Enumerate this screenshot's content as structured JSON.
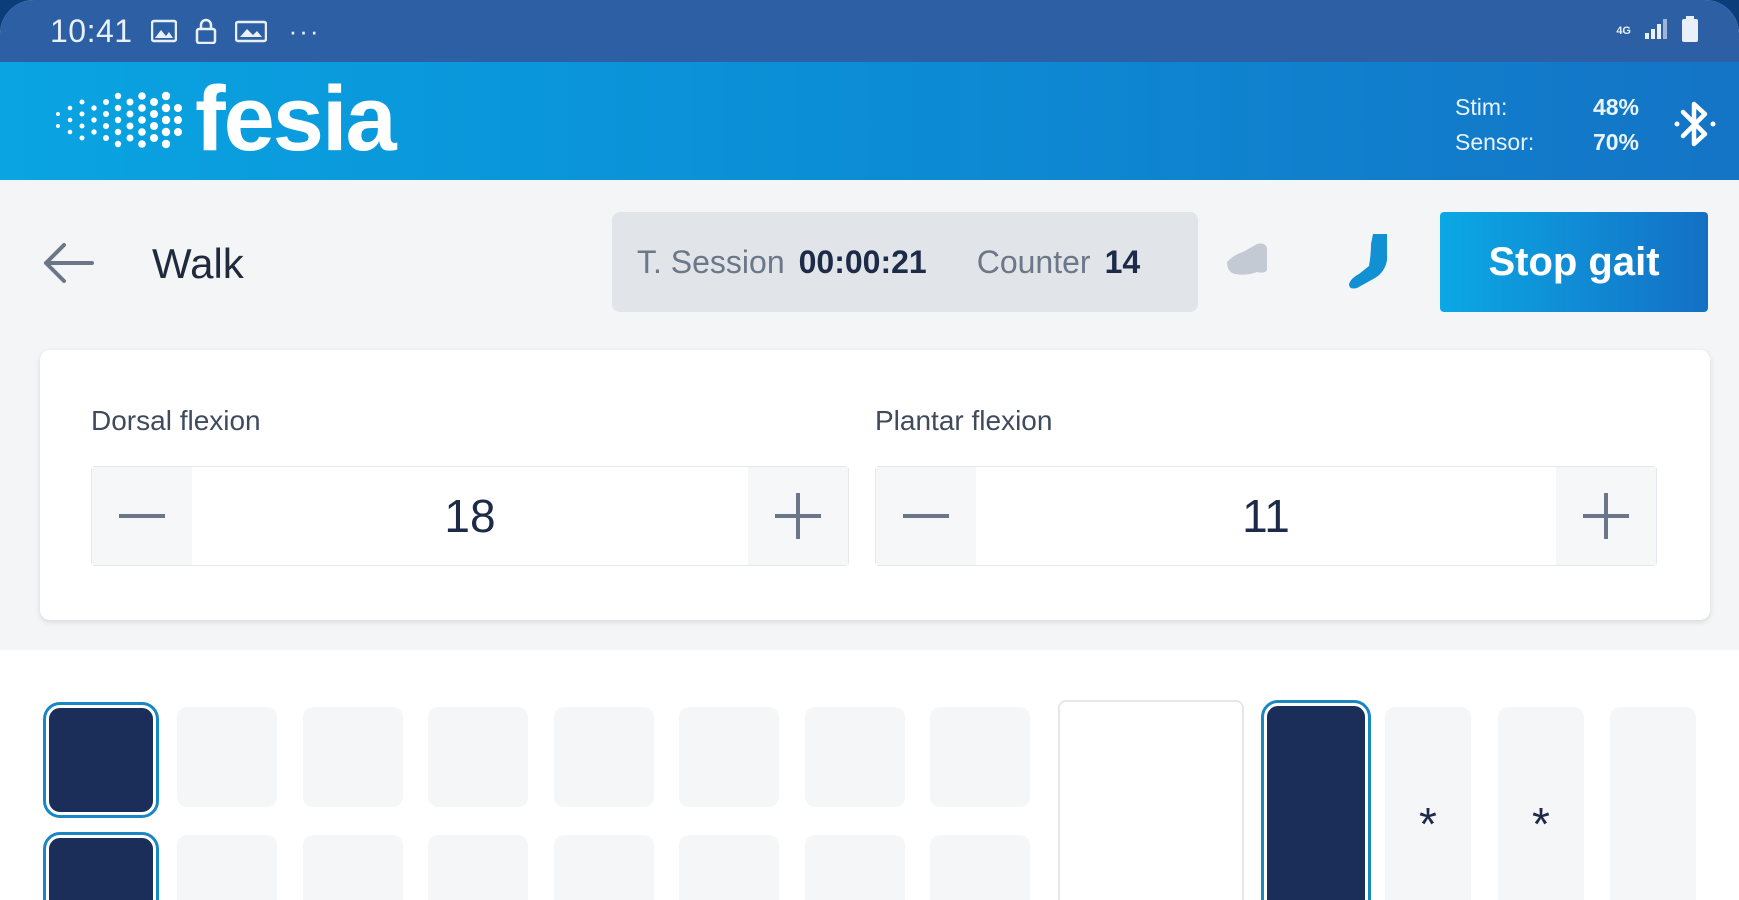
{
  "status_bar": {
    "time": "10:41",
    "icons": [
      "image-icon",
      "lock-icon",
      "gallery-icon"
    ],
    "more": "···",
    "network": "4G",
    "right_icons": [
      "signal-icon",
      "battery-icon"
    ]
  },
  "header": {
    "logo_text": "fesia",
    "stim_label": "Stim:",
    "stim_value": "48%",
    "sensor_label": "Sensor:",
    "sensor_value": "70%",
    "bluetooth_icon": "bluetooth-icon"
  },
  "toolbar": {
    "back_icon": "arrow-left-icon",
    "title": "Walk",
    "session_label": "T. Session",
    "session_value": "00:00:21",
    "counter_label": "Counter",
    "counter_value": "14",
    "stop_label": "Stop gait"
  },
  "flexion": {
    "dorsal_label": "Dorsal flexion",
    "dorsal_value": "18",
    "plantar_label": "Plantar flexion",
    "plantar_value": "11"
  },
  "grid": {
    "star_1": "*",
    "star_2": "*"
  },
  "colors": {
    "status_bar": "#2c5fa4",
    "accent": "#0b8fd6",
    "active_cell": "#1b2e5a",
    "active_outline": "#1a87c4"
  }
}
